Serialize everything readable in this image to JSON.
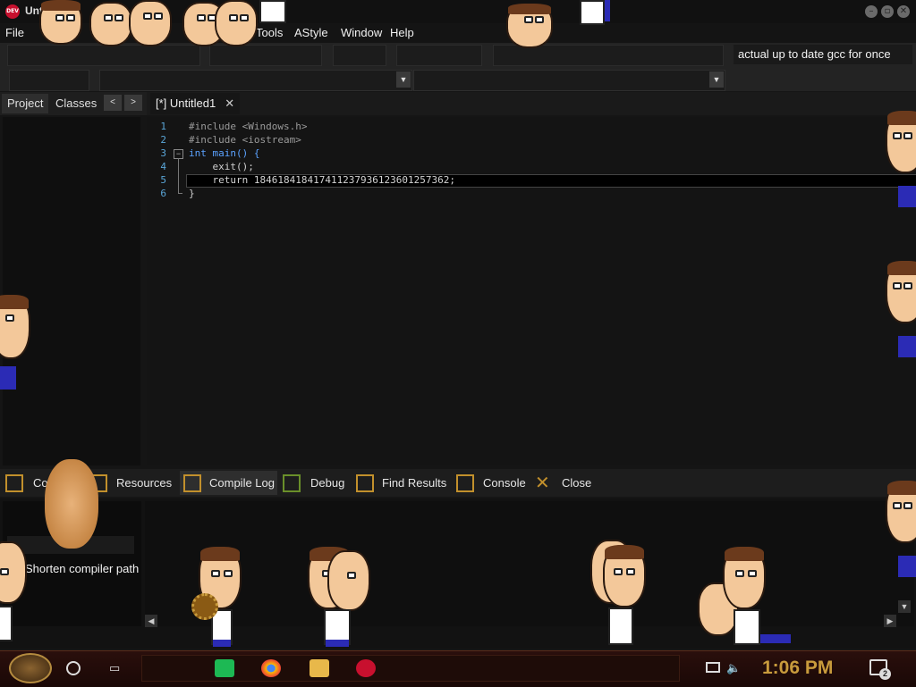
{
  "window": {
    "title": "Untitled1",
    "app_icon_text": "DEV"
  },
  "menu": [
    "File",
    "Tools",
    "AStyle",
    "Window",
    "Help"
  ],
  "toolbar": {
    "compiler_label": "actual up to date gcc for once"
  },
  "left_panel": {
    "tabs": [
      "Project",
      "Classes"
    ],
    "nav_prev": "<",
    "nav_next": ">"
  },
  "editor": {
    "tab_label": "[*] Untitled1",
    "tab_close": "✕",
    "lines": [
      {
        "n": "1",
        "text": "#include <Windows.h>"
      },
      {
        "n": "2",
        "text": "#include <iostream>"
      },
      {
        "n": "3",
        "text": "int main() {"
      },
      {
        "n": "4",
        "text": "    exit();"
      },
      {
        "n": "5",
        "text": "    return 184618418417411237936123601257362;"
      },
      {
        "n": "6",
        "text": "}"
      }
    ]
  },
  "bottom_tabs": [
    "Co",
    "Resources",
    "Compile Log",
    "Debug",
    "Find Results",
    "Console",
    "Close"
  ],
  "bottom_panel": {
    "shorten_label": "Shorten compiler path"
  },
  "taskbar": {
    "time": "1:06 PM",
    "notifications": "2"
  },
  "colors": {
    "accent": "#c89b3c",
    "keyword": "#5ba2ff",
    "line_number": "#5aa6d8"
  }
}
